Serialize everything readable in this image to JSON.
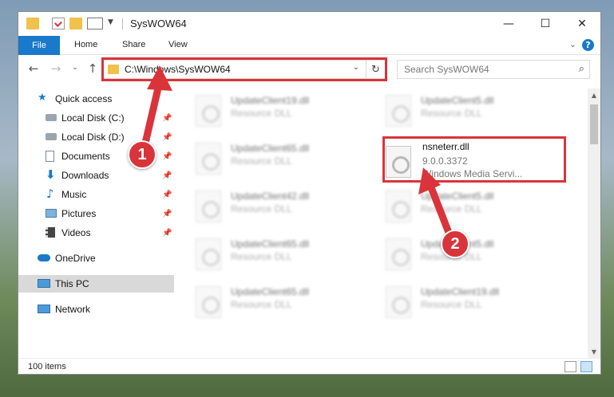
{
  "window": {
    "title": "SysWOW64",
    "controls": {
      "minimize": "—",
      "maximize": "☐",
      "close": "✕"
    }
  },
  "ribbon": {
    "tabs": [
      "File",
      "Home",
      "Share",
      "View"
    ],
    "help": "?"
  },
  "nav": {
    "address": "C:\\Windows\\SysWOW64",
    "search_placeholder": "Search SysWOW64"
  },
  "sidebar": {
    "items": [
      {
        "label": "Quick access",
        "icon": "star-icon"
      },
      {
        "label": "Local Disk (C:)",
        "icon": "drive-icon",
        "pinned": true
      },
      {
        "label": "Local Disk (D:)",
        "icon": "drive-icon",
        "pinned": true
      },
      {
        "label": "Documents",
        "icon": "documents-icon",
        "pinned": true
      },
      {
        "label": "Downloads",
        "icon": "download-icon",
        "pinned": true
      },
      {
        "label": "Music",
        "icon": "music-icon",
        "pinned": true
      },
      {
        "label": "Pictures",
        "icon": "pictures-icon",
        "pinned": true
      },
      {
        "label": "Videos",
        "icon": "videos-icon",
        "pinned": true
      },
      {
        "label": "OneDrive",
        "icon": "cloud-icon"
      },
      {
        "label": "This PC",
        "icon": "computer-icon",
        "selected": true
      },
      {
        "label": "Network",
        "icon": "network-icon"
      }
    ]
  },
  "files": {
    "left": [
      {
        "name": "UpdateClient19.dll",
        "type": "Resource DLL"
      },
      {
        "name": "UpdateClient65.dll",
        "type": "Resource DLL"
      },
      {
        "name": "UpdateClient42.dll",
        "type": "Resource DLL"
      },
      {
        "name": "UpdateClient65.dll",
        "type": "Resource DLL"
      },
      {
        "name": "UpdateClient65.dll",
        "type": "Resource DLL"
      }
    ],
    "right": [
      {
        "name": "UpdateClient5.dll",
        "type": "Resource DLL"
      },
      {
        "name": "UpdateClient5.dll",
        "type": "Resource DLL"
      },
      {
        "name": "UpdateClient5.dll",
        "type": "Resource DLL"
      },
      {
        "name": "UpdateClient19.dll",
        "type": "Resource DLL"
      }
    ],
    "highlighted": {
      "name": "nsneterr.dll",
      "version": "9.0.0.3372",
      "description": "Windows Media Servi..."
    }
  },
  "status": {
    "item_count": "100 items"
  },
  "annotations": {
    "step1": "1",
    "step2": "2",
    "color": "#d9343a"
  }
}
